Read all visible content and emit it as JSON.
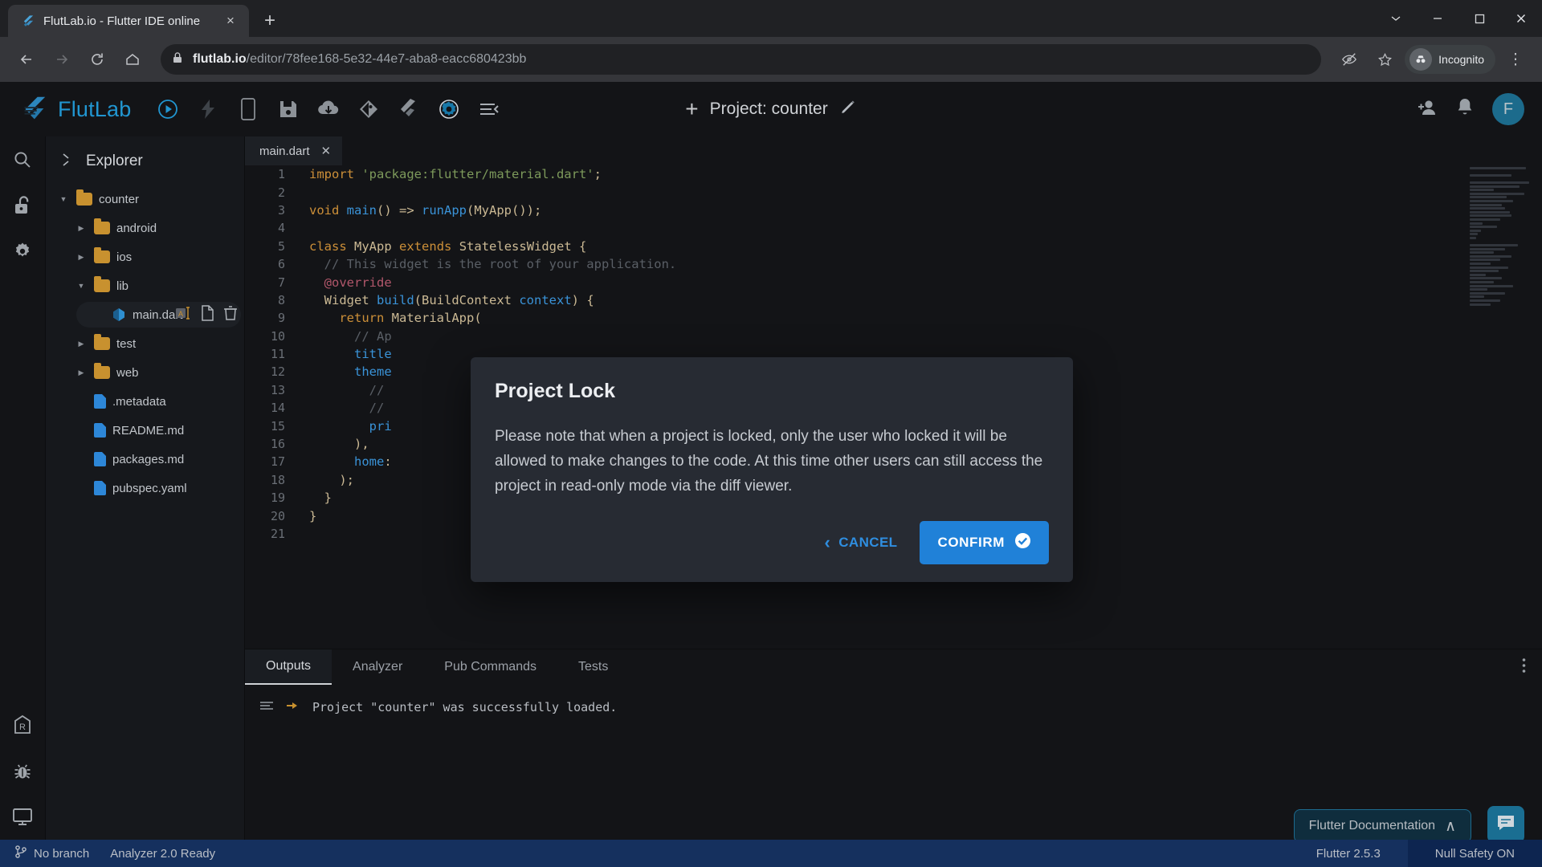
{
  "browser": {
    "tab": {
      "title": "FlutLab.io - Flutter IDE online",
      "favicon": "flutlab-f-icon",
      "close": "×"
    },
    "newtab_label": "+",
    "window_controls": {
      "minimize": "–",
      "maximize": "□",
      "close": "✕",
      "chevron": "⌄"
    },
    "nav": {
      "back": "←",
      "forward": "→",
      "reload": "⟳",
      "home": "⌂"
    },
    "omnibox": {
      "lock": "lock-icon",
      "domain": "flutlab.io",
      "path": "/editor/78fee168-5e32-44e7-aba8-eacc680423bb"
    },
    "incognito_label": "Incognito",
    "menu": "⋮"
  },
  "appbar": {
    "brand": "FlutLab",
    "tools": [
      "run-icon",
      "hot-reload-icon",
      "device-icon",
      "save-icon",
      "download-icon",
      "git-icon",
      "flutter-icon",
      "settings-gear-icon",
      "collapse-icon"
    ],
    "project_plus": "+",
    "project_title": "Project: counter",
    "edit_icon": "pencil-icon",
    "right_icons": [
      "add-user-icon",
      "bell-icon"
    ],
    "avatar_initial": "F"
  },
  "rail": {
    "top": [
      "search-icon",
      "unlock-icon",
      "gear-icon"
    ],
    "bottom": [
      "release-icon",
      "bug-icon",
      "monitor-icon"
    ]
  },
  "explorer": {
    "collapse_icon": "collapse-chevrons-icon",
    "title": "Explorer",
    "tree": [
      {
        "label": "counter",
        "type": "folder",
        "depth": 0,
        "expanded": true,
        "selected": false
      },
      {
        "label": "android",
        "type": "folder",
        "depth": 1,
        "expanded": false,
        "selected": false
      },
      {
        "label": "ios",
        "type": "folder",
        "depth": 1,
        "expanded": false,
        "selected": false
      },
      {
        "label": "lib",
        "type": "folder",
        "depth": 1,
        "expanded": true,
        "selected": false
      },
      {
        "label": "main.dart",
        "type": "dart",
        "depth": 2,
        "expanded": null,
        "selected": true
      },
      {
        "label": "test",
        "type": "folder",
        "depth": 1,
        "expanded": false,
        "selected": false
      },
      {
        "label": "web",
        "type": "folder",
        "depth": 1,
        "expanded": false,
        "selected": false
      },
      {
        "label": ".metadata",
        "type": "file",
        "depth": 1,
        "expanded": null,
        "selected": false
      },
      {
        "label": "README.md",
        "type": "file",
        "depth": 1,
        "expanded": null,
        "selected": false
      },
      {
        "label": "packages.md",
        "type": "file",
        "depth": 1,
        "expanded": null,
        "selected": false
      },
      {
        "label": "pubspec.yaml",
        "type": "file",
        "depth": 1,
        "expanded": null,
        "selected": false
      }
    ],
    "row_actions": [
      "rename-icon",
      "copy-icon",
      "delete-icon"
    ]
  },
  "editor": {
    "open_tab": {
      "label": "main.dart",
      "close": "✕"
    },
    "code": [
      {
        "n": 1,
        "tokens": [
          [
            "kw",
            "import"
          ],
          [
            "pun",
            " "
          ],
          [
            "str",
            "'package:flutter/material.dart'"
          ],
          [
            "pun",
            ";"
          ]
        ]
      },
      {
        "n": 2,
        "tokens": []
      },
      {
        "n": 3,
        "tokens": [
          [
            "kw",
            "void"
          ],
          [
            "pun",
            " "
          ],
          [
            "fn",
            "main"
          ],
          [
            "pun",
            "() => "
          ],
          [
            "fn",
            "runApp"
          ],
          [
            "pun",
            "("
          ],
          [
            "typ",
            "MyApp"
          ],
          [
            "pun",
            "());"
          ]
        ]
      },
      {
        "n": 4,
        "tokens": []
      },
      {
        "n": 5,
        "tokens": [
          [
            "kw",
            "class"
          ],
          [
            "pun",
            " "
          ],
          [
            "typ",
            "MyApp"
          ],
          [
            "pun",
            " "
          ],
          [
            "kw",
            "extends"
          ],
          [
            "pun",
            " "
          ],
          [
            "typ",
            "StatelessWidget"
          ],
          [
            "pun",
            " {"
          ]
        ]
      },
      {
        "n": 6,
        "tokens": [
          [
            "cmt",
            "  // This widget is the root of your application."
          ]
        ]
      },
      {
        "n": 7,
        "tokens": [
          [
            "ann",
            "  @override"
          ]
        ]
      },
      {
        "n": 8,
        "tokens": [
          [
            "typ",
            "  Widget"
          ],
          [
            "pun",
            " "
          ],
          [
            "fn",
            "build"
          ],
          [
            "pun",
            "("
          ],
          [
            "typ",
            "BuildContext"
          ],
          [
            "pun",
            " "
          ],
          [
            "prop",
            "context"
          ],
          [
            "pun",
            ") {"
          ]
        ]
      },
      {
        "n": 9,
        "tokens": [
          [
            "kw",
            "    return"
          ],
          [
            "pun",
            " "
          ],
          [
            "typ",
            "MaterialApp"
          ],
          [
            "pun",
            "("
          ]
        ]
      },
      {
        "n": 10,
        "tokens": [
          [
            "cmt",
            "      // Ap"
          ]
        ]
      },
      {
        "n": 11,
        "tokens": [
          [
            "prop",
            "      title"
          ]
        ]
      },
      {
        "n": 12,
        "tokens": [
          [
            "prop",
            "      theme"
          ]
        ]
      },
      {
        "n": 13,
        "tokens": [
          [
            "cmt",
            "        // "
          ]
        ]
      },
      {
        "n": 14,
        "tokens": [
          [
            "cmt",
            "        // "
          ]
        ]
      },
      {
        "n": 15,
        "tokens": [
          [
            "prop",
            "        pri"
          ]
        ]
      },
      {
        "n": 16,
        "tokens": [
          [
            "pun",
            "      ),"
          ]
        ]
      },
      {
        "n": 17,
        "tokens": [
          [
            "prop",
            "      home"
          ],
          [
            "pun",
            ":"
          ]
        ]
      },
      {
        "n": 18,
        "tokens": [
          [
            "pun",
            "    );"
          ]
        ]
      },
      {
        "n": 19,
        "tokens": [
          [
            "pun",
            "  }"
          ]
        ]
      },
      {
        "n": 20,
        "tokens": [
          [
            "pun",
            "}"
          ]
        ]
      },
      {
        "n": 21,
        "tokens": []
      }
    ]
  },
  "panel": {
    "tabs": [
      {
        "label": "Outputs",
        "active": true
      },
      {
        "label": "Analyzer",
        "active": false
      },
      {
        "label": "Pub Commands",
        "active": false
      },
      {
        "label": "Tests",
        "active": false
      }
    ],
    "menu_icon": "kebab-menu-icon",
    "output": {
      "list_icon": "list-icon",
      "pointer_icon": "pointer-hand-icon",
      "message": "Project \"counter\" was successfully loaded."
    }
  },
  "floating": {
    "doc_button": {
      "label": "Flutter Documentation",
      "chevron": "∧"
    },
    "chat_button": "chat-icon"
  },
  "status": {
    "branch_icon": "git-branch-icon",
    "branch": "No branch",
    "analyzer": "Analyzer 2.0 Ready",
    "flutter_version": "Flutter 2.5.3",
    "null_safety": "Null Safety ON"
  },
  "modal": {
    "title": "Project Lock",
    "body": "Please note that when a project is locked, only the user who locked it will be allowed to make changes to the code. At this time other users can still access the project in read-only mode via the diff viewer.",
    "cancel_label": "CANCEL",
    "cancel_chevron": "‹",
    "confirm_label": "CONFIRM",
    "confirm_icon": "check-circle-icon"
  },
  "colors": {
    "accent": "#2081d8",
    "brand": "#2196d1",
    "folder": "#c8912f",
    "status_bar": "#15305e"
  }
}
